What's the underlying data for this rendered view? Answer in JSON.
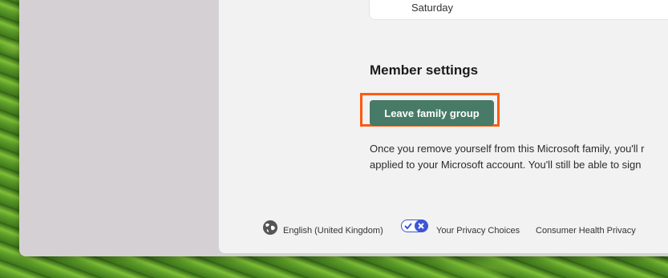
{
  "card": {
    "text": "Saturday"
  },
  "member_settings": {
    "title": "Member settings",
    "leave_button": "Leave family group",
    "description_line1": "Once you remove yourself from this Microsoft family, you'll r",
    "description_line2": "applied to your Microsoft account. You'll still be able to sign"
  },
  "footer": {
    "language": "English (United Kingdom)",
    "privacy_choices": "Your Privacy Choices",
    "health_privacy": "Consumer Health Privacy"
  },
  "colors": {
    "button": "#477b67",
    "highlight": "#ff5a0f",
    "toggle": "#3c55d6"
  },
  "icons": [
    "globe-icon",
    "privacy-toggle-icon"
  ]
}
